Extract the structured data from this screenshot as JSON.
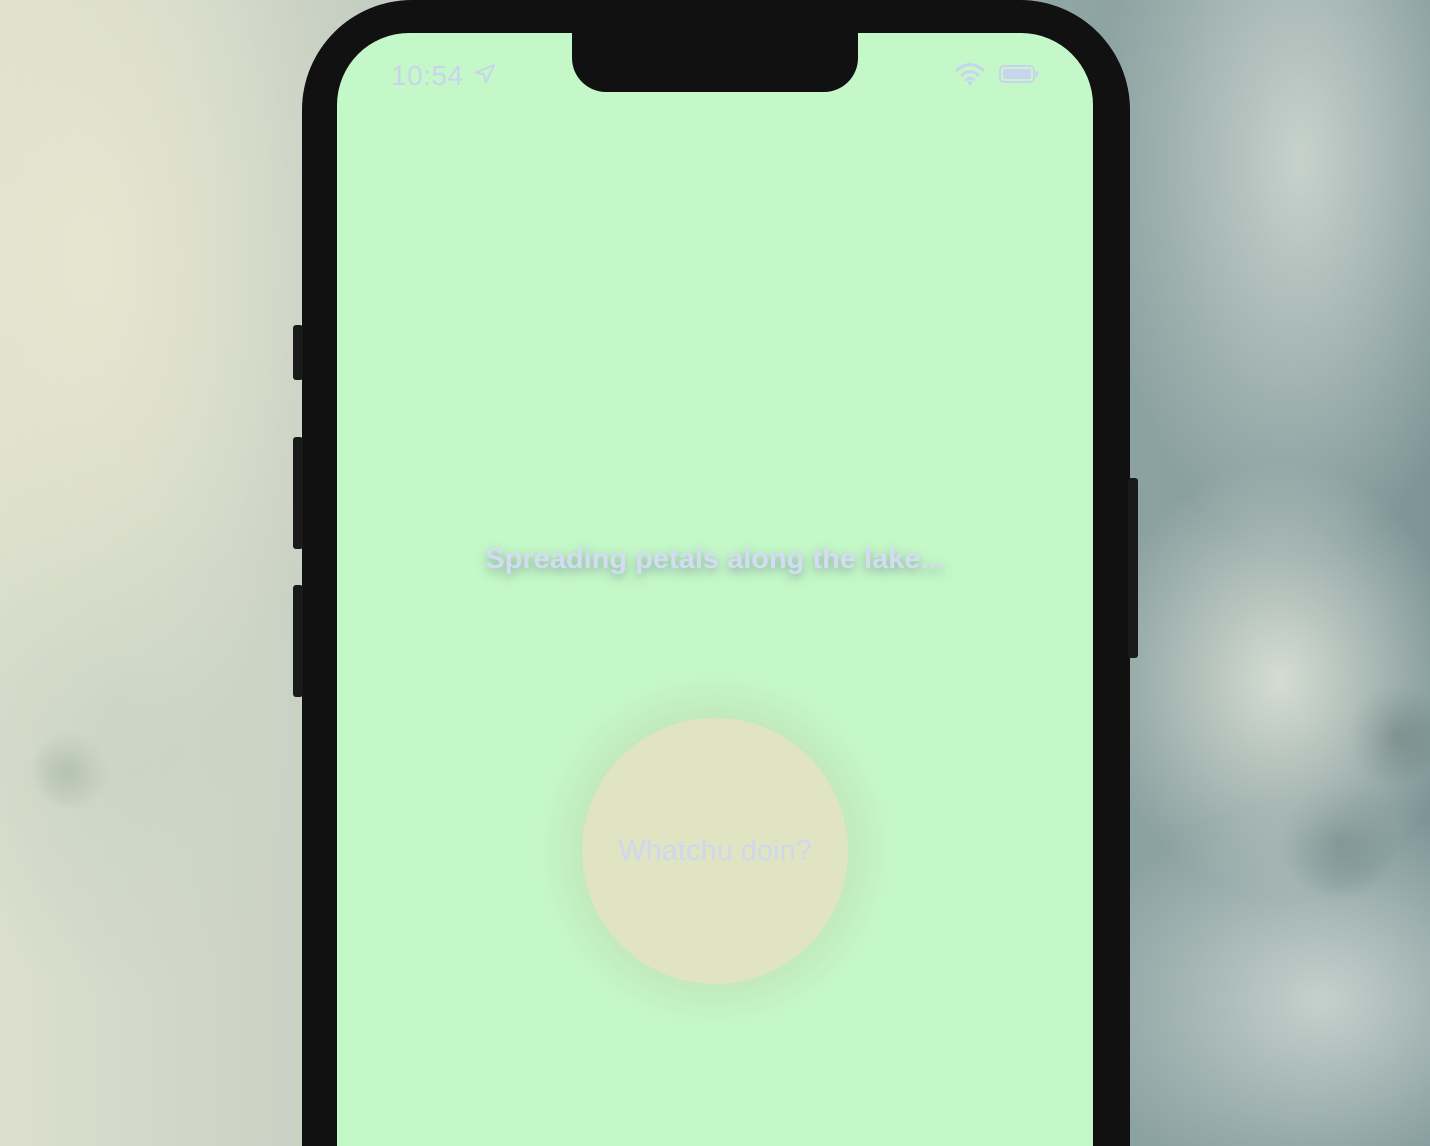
{
  "status_bar": {
    "time": "10:54",
    "location_icon": "location-arrow-icon",
    "wifi_icon": "wifi-icon",
    "battery_icon": "battery-icon"
  },
  "main": {
    "headline": "Spreading petals along the lake...",
    "circle_button_label": "Whatchu doin?"
  },
  "colors": {
    "screen_background": "#c4f8c8",
    "circle_fill": "#e0e4c2",
    "text": "#d3dcf0",
    "phone_frame": "#111111"
  }
}
